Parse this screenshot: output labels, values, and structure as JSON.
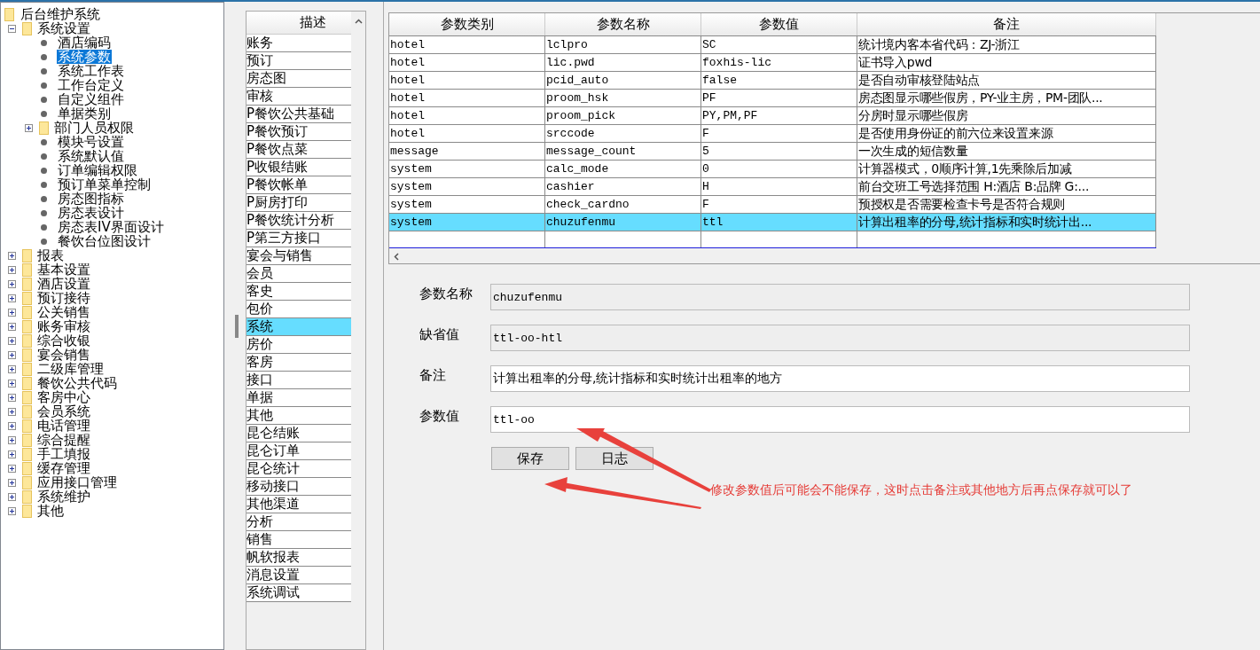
{
  "tree": {
    "label": "后台维护系统",
    "kind": "root",
    "selected": false,
    "children": [
      {
        "label": "系统设置",
        "kind": "folder",
        "expanded": true,
        "selected": false,
        "children": [
          {
            "label": "酒店编码",
            "kind": "leaf",
            "selected": false
          },
          {
            "label": "系统参数",
            "kind": "leaf",
            "selected": true
          },
          {
            "label": "系统工作表",
            "kind": "leaf",
            "selected": false
          },
          {
            "label": "工作台定义",
            "kind": "leaf",
            "selected": false
          },
          {
            "label": "自定义组件",
            "kind": "leaf",
            "selected": false
          },
          {
            "label": "单据类别",
            "kind": "leaf",
            "selected": false
          },
          {
            "label": "部门人员权限",
            "kind": "folder",
            "expanded": false,
            "selected": false
          },
          {
            "label": "模块号设置",
            "kind": "leaf",
            "selected": false
          },
          {
            "label": "系统默认值",
            "kind": "leaf",
            "selected": false
          },
          {
            "label": "订单编辑权限",
            "kind": "leaf",
            "selected": false
          },
          {
            "label": "预订单菜单控制",
            "kind": "leaf",
            "selected": false
          },
          {
            "label": "房态图指标",
            "kind": "leaf",
            "selected": false
          },
          {
            "label": "房态表设计",
            "kind": "leaf",
            "selected": false
          },
          {
            "label": "房态表IV界面设计",
            "kind": "leaf",
            "selected": false
          },
          {
            "label": "餐饮台位图设计",
            "kind": "leaf",
            "selected": false
          }
        ]
      },
      {
        "label": "报表",
        "kind": "folder",
        "expanded": false,
        "selected": false
      },
      {
        "label": "基本设置",
        "kind": "folder",
        "expanded": false,
        "selected": false
      },
      {
        "label": "酒店设置",
        "kind": "folder",
        "expanded": false,
        "selected": false
      },
      {
        "label": "预订接待",
        "kind": "folder",
        "expanded": false,
        "selected": false
      },
      {
        "label": "公关销售",
        "kind": "folder",
        "expanded": false,
        "selected": false
      },
      {
        "label": "账务审核",
        "kind": "folder",
        "expanded": false,
        "selected": false
      },
      {
        "label": "综合收银",
        "kind": "folder",
        "expanded": false,
        "selected": false
      },
      {
        "label": "宴会销售",
        "kind": "folder",
        "expanded": false,
        "selected": false
      },
      {
        "label": "二级库管理",
        "kind": "folder",
        "expanded": false,
        "selected": false
      },
      {
        "label": "餐饮公共代码",
        "kind": "folder",
        "expanded": false,
        "selected": false
      },
      {
        "label": "客房中心",
        "kind": "folder",
        "expanded": false,
        "selected": false
      },
      {
        "label": "会员系统",
        "kind": "folder",
        "expanded": false,
        "selected": false
      },
      {
        "label": "电话管理",
        "kind": "folder",
        "expanded": false,
        "selected": false
      },
      {
        "label": "综合提醒",
        "kind": "folder",
        "expanded": false,
        "selected": false
      },
      {
        "label": "手工填报",
        "kind": "folder",
        "expanded": false,
        "selected": false
      },
      {
        "label": "缓存管理",
        "kind": "folder",
        "expanded": false,
        "selected": false
      },
      {
        "label": "应用接口管理",
        "kind": "folder",
        "expanded": false,
        "selected": false
      },
      {
        "label": "系统维护",
        "kind": "folder",
        "expanded": false,
        "selected": false
      },
      {
        "label": "其他",
        "kind": "folder",
        "expanded": false,
        "selected": false
      }
    ]
  },
  "category_list": {
    "header": "描述",
    "items": [
      {
        "label": "账务",
        "selected": false
      },
      {
        "label": "预订",
        "selected": false
      },
      {
        "label": "房态图",
        "selected": false
      },
      {
        "label": "审核",
        "selected": false
      },
      {
        "label": "P餐饮公共基础",
        "selected": false
      },
      {
        "label": "P餐饮预订",
        "selected": false
      },
      {
        "label": "P餐饮点菜",
        "selected": false
      },
      {
        "label": "P收银结账",
        "selected": false
      },
      {
        "label": "P餐饮帐单",
        "selected": false
      },
      {
        "label": "P厨房打印",
        "selected": false
      },
      {
        "label": "P餐饮统计分析",
        "selected": false
      },
      {
        "label": "P第三方接口",
        "selected": false
      },
      {
        "label": "宴会与销售",
        "selected": false
      },
      {
        "label": "会员",
        "selected": false
      },
      {
        "label": "客史",
        "selected": false
      },
      {
        "label": "包价",
        "selected": false
      },
      {
        "label": "系统",
        "selected": true
      },
      {
        "label": "房价",
        "selected": false
      },
      {
        "label": "客房",
        "selected": false
      },
      {
        "label": "接口",
        "selected": false
      },
      {
        "label": "单据",
        "selected": false
      },
      {
        "label": "其他",
        "selected": false
      },
      {
        "label": "昆仑结账",
        "selected": false
      },
      {
        "label": "昆仑订单",
        "selected": false
      },
      {
        "label": "昆仑统计",
        "selected": false
      },
      {
        "label": "移动接口",
        "selected": false
      },
      {
        "label": "其他渠道",
        "selected": false
      },
      {
        "label": "分析",
        "selected": false
      },
      {
        "label": "销售",
        "selected": false
      },
      {
        "label": "帆软报表",
        "selected": false
      },
      {
        "label": "消息设置",
        "selected": false
      },
      {
        "label": "系统调试",
        "selected": false
      }
    ]
  },
  "table": {
    "columns": [
      "参数类别",
      "参数名称",
      "参数值",
      "备注"
    ],
    "rows": [
      {
        "cells": [
          "hotel",
          "lclpro",
          "SC",
          "统计境内客本省代码：ZJ-浙江"
        ],
        "selected": false
      },
      {
        "cells": [
          "hotel",
          "lic.pwd",
          "foxhis-lic",
          "证书导入pwd"
        ],
        "selected": false
      },
      {
        "cells": [
          "hotel",
          "pcid_auto",
          "false",
          "是否自动审核登陆站点"
        ],
        "selected": false
      },
      {
        "cells": [
          "hotel",
          "proom_hsk",
          "PF",
          "房态图显示哪些假房，PY-业主房，PM-团队..."
        ],
        "selected": false
      },
      {
        "cells": [
          "hotel",
          "proom_pick",
          "PY,PM,PF",
          "分房时显示哪些假房"
        ],
        "selected": false
      },
      {
        "cells": [
          "hotel",
          "srccode",
          "F",
          "是否使用身份证的前六位来设置来源"
        ],
        "selected": false
      },
      {
        "cells": [
          "message",
          "message_count",
          "5",
          "一次生成的短信数量"
        ],
        "selected": false
      },
      {
        "cells": [
          "system",
          "calc_mode",
          "0",
          "计算器模式，0顺序计算,1先乘除后加减"
        ],
        "selected": false
      },
      {
        "cells": [
          "system",
          "cashier",
          "H",
          "前台交班工号选择范围 H:酒店  B:品牌 G:..."
        ],
        "selected": false
      },
      {
        "cells": [
          "system",
          "check_cardno",
          "F",
          "预授权是否需要检查卡号是否符合规则"
        ],
        "selected": false
      },
      {
        "cells": [
          "system",
          "chuzufenmu",
          "ttl",
          "计算出租率的分母,统计指标和实时统计出..."
        ],
        "selected": true
      }
    ]
  },
  "form": {
    "fields": [
      {
        "label": "参数名称",
        "value": "chuzufenmu",
        "disabled": true
      },
      {
        "label": "缺省值",
        "value": "ttl-oo-htl",
        "disabled": true
      },
      {
        "label": "备注",
        "value": "计算出租率的分母,统计指标和实时统计出租率的地方",
        "disabled": false
      },
      {
        "label": "参数值",
        "value": "ttl-oo",
        "disabled": false
      }
    ],
    "buttons": [
      "保存",
      "日志"
    ]
  },
  "annotation": {
    "text": "修改参数值后可能会不能保存，这时点击备注或其他地方后再点保存就可以了"
  }
}
